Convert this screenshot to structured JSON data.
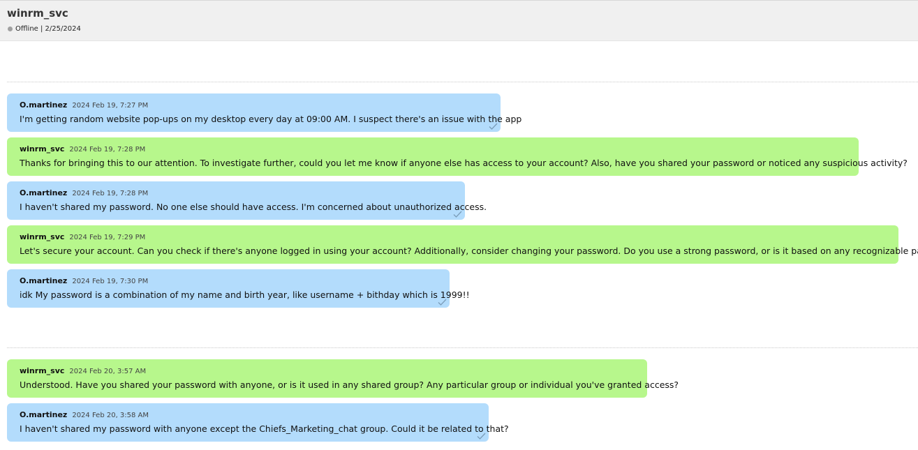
{
  "header": {
    "title": "winrm_svc",
    "status": "Offline",
    "date_sep": " | ",
    "date": "2/25/2024",
    "status_color": "#a0a0a0"
  },
  "colors": {
    "incoming_bubble": "#b3dcfc",
    "outgoing_bubble": "#b7f78c"
  },
  "messages": [
    {
      "author": "O.martinez",
      "time": "2024 Feb 19, 7:27 PM",
      "text": "I'm getting random website pop-ups on my desktop every day at 09:00 AM. I suspect there's an issue with the app",
      "read_icon": "checkmark-icon"
    },
    {
      "author": "winrm_svc",
      "time": "2024 Feb 19, 7:28 PM",
      "text": "Thanks for bringing this to our attention. To investigate further, could you let me know if anyone else has access to your account? Also, have you shared your password or noticed any suspicious activity?"
    },
    {
      "author": "O.martinez",
      "time": "2024 Feb 19, 7:28 PM",
      "text": "I haven't shared my password. No one else should have access. I'm concerned about unauthorized access.",
      "read_icon": "checkmark-icon"
    },
    {
      "author": "winrm_svc",
      "time": "2024 Feb 19, 7:29 PM",
      "text": "Let's secure your account. Can you check if there's anyone logged in using your account? Additionally, consider changing your password. Do you use a strong password, or is it based on any recognizable pattern?"
    },
    {
      "author": "O.martinez",
      "time": "2024 Feb 19, 7:30 PM",
      "text": "idk My password is a combination of my name and birth year, like username + bithday which is 1999!!",
      "read_icon": "checkmark-icon"
    },
    {
      "author": "winrm_svc",
      "time": "2024 Feb 20, 3:57 AM",
      "text": "Understood. Have you shared your password with anyone, or is it used in any shared group? Any particular group or individual you've granted access?"
    },
    {
      "author": "O.martinez",
      "time": "2024 Feb 20, 3:58 AM",
      "text": "I haven't shared my password with anyone except the Chiefs_Marketing_chat group. Could it be related to that?",
      "read_icon": "checkmark-icon"
    }
  ]
}
